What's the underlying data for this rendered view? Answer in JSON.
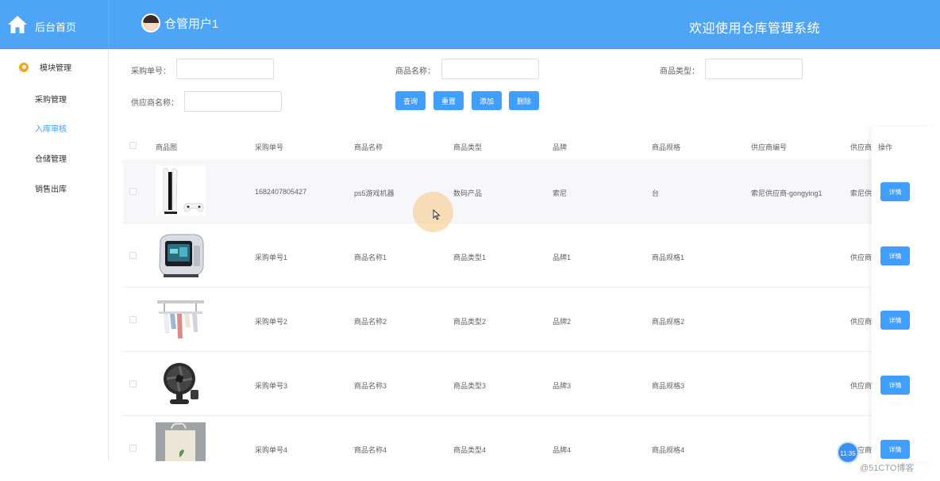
{
  "header": {
    "home_label": "后台首页",
    "username": "仓管用户1",
    "welcome": "欢迎使用仓库管理系统",
    "accent": "#4ea5f5"
  },
  "sidebar": {
    "group_label": "模块管理",
    "items": [
      {
        "label": "采购管理",
        "active": false
      },
      {
        "label": "入库审核",
        "active": true
      },
      {
        "label": "仓储管理",
        "active": false
      },
      {
        "label": "销售出库",
        "active": false
      }
    ]
  },
  "search": {
    "purchase_no_label": "采购单号：",
    "product_name_label": "商品名称：",
    "product_type_label": "商品类型：",
    "supplier_name_label": "供应商名称：",
    "purchase_no_value": "",
    "product_name_value": "",
    "product_type_value": "",
    "supplier_name_value": ""
  },
  "buttons": {
    "query": "查询",
    "reset": "重置",
    "add": "添加",
    "delete": "删除"
  },
  "table": {
    "columns": [
      "商品图",
      "采购单号",
      "商品名称",
      "商品类型",
      "品牌",
      "商品规格",
      "供应商编号",
      "供应商",
      "操作"
    ],
    "detail_label": "详情",
    "rows": [
      {
        "image": "ps5-console",
        "purchase_no": "1682407805427",
        "name": "ps5游戏机器",
        "type": "数码产品",
        "brand": "索尼",
        "spec": "台",
        "supplier_no": "索尼供应商-gongying1",
        "supplier": "索尼供"
      },
      {
        "image": "mini-pc",
        "purchase_no": "采购单号1",
        "name": "商品名称1",
        "type": "商品类型1",
        "brand": "品牌1",
        "spec": "商品规格1",
        "supplier_no": "",
        "supplier": "供应商"
      },
      {
        "image": "clothes-rack",
        "purchase_no": "采购单号2",
        "name": "商品名称2",
        "type": "商品类型2",
        "brand": "品牌2",
        "spec": "商品规格2",
        "supplier_no": "",
        "supplier": "供应商"
      },
      {
        "image": "desk-fan",
        "purchase_no": "采购单号3",
        "name": "商品名称3",
        "type": "商品类型3",
        "brand": "品牌3",
        "spec": "商品规格3",
        "supplier_no": "",
        "supplier": "供应商"
      },
      {
        "image": "tote-bag",
        "purchase_no": "采购单号4",
        "name": "商品名称4",
        "type": "商品类型4",
        "brand": "品牌4",
        "spec": "商品规格4",
        "supplier_no": "",
        "supplier": "供应商"
      }
    ]
  },
  "overlay": {
    "clock": "11:35",
    "watermark": "@51CTO博客"
  }
}
